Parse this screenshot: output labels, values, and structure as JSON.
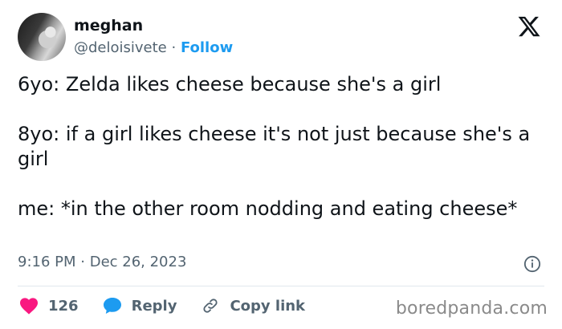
{
  "author": {
    "display_name": "meghan",
    "handle": "@deloisivete",
    "separator": " · ",
    "follow_label": "Follow",
    "avatar_icon": "avatar-photo"
  },
  "platform_icon": "x-logo-icon",
  "tweet": {
    "paragraphs": [
      "6yo: Zelda likes cheese because she's a girl",
      "8yo: if a girl likes cheese it's not just because she's a girl",
      "me: *in the other room nodding and eating cheese*"
    ]
  },
  "meta": {
    "time": "9:16 PM",
    "dot": " · ",
    "date": "Dec 26, 2023",
    "info_icon": "info-icon"
  },
  "actions": {
    "like_count": "126",
    "like_icon": "heart-icon",
    "reply_label": "Reply",
    "reply_icon": "speech-bubble-icon",
    "copy_link_label": "Copy link",
    "copy_link_icon": "link-icon"
  },
  "watermark": "boredpanda.com",
  "colors": {
    "accent": "#1d9bf0",
    "heart": "#f91880",
    "reply_bubble": "#1d9bf0",
    "secondary_text": "#536471"
  }
}
